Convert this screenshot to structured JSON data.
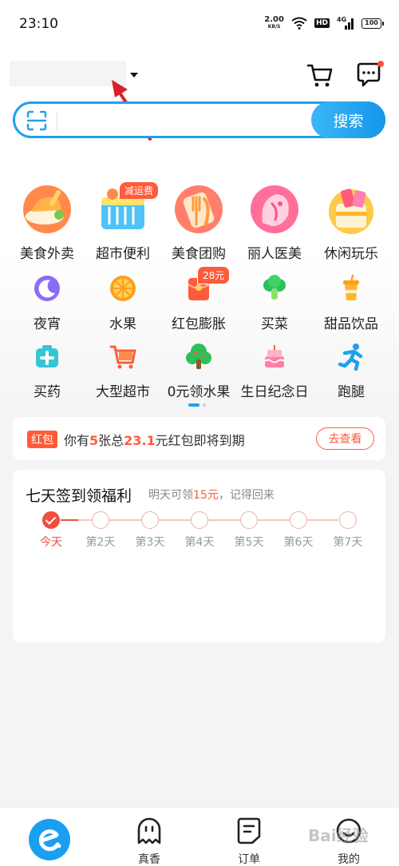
{
  "status_bar": {
    "time": "23:10",
    "net_speed_value": "2.00",
    "net_speed_unit": "KB/S",
    "hd_badge": "HD",
    "signal_label": "4G",
    "battery_text": "100"
  },
  "header": {
    "location_text": "",
    "icons": [
      "cart-icon",
      "message-icon"
    ]
  },
  "search": {
    "placeholder": "",
    "button_label": "搜索"
  },
  "main_categories": [
    {
      "label": "美食外卖",
      "icon": "food-delivery-icon"
    },
    {
      "label": "超市便利",
      "icon": "supermarket-basket-icon",
      "badge": "减运费"
    },
    {
      "label": "美食团购",
      "icon": "group-buy-food-icon"
    },
    {
      "label": "丽人医美",
      "icon": "beauty-icon"
    },
    {
      "label": "休闲玩乐",
      "icon": "leisure-icon"
    }
  ],
  "sub_categories": [
    {
      "label": "夜宵",
      "icon": "moon-icon"
    },
    {
      "label": "水果",
      "icon": "orange-icon"
    },
    {
      "label": "红包膨胀",
      "icon": "red-packet-icon",
      "badge": "28元"
    },
    {
      "label": "买菜",
      "icon": "vegetable-icon"
    },
    {
      "label": "甜品饮品",
      "icon": "drink-icon"
    },
    {
      "label": "买药",
      "icon": "medicine-box-icon"
    },
    {
      "label": "大型超市",
      "icon": "shopping-cart-icon"
    },
    {
      "label": "0元领水果",
      "icon": "tree-icon"
    },
    {
      "label": "生日纪念日",
      "icon": "cake-icon"
    },
    {
      "label": "跑腿",
      "icon": "runner-icon"
    }
  ],
  "red_packet_notice": {
    "tag": "红包",
    "text_before": "你有",
    "count": "5",
    "text_mid": "张总",
    "amount": "23.1",
    "text_after": "元红包即将到期",
    "button": "去查看"
  },
  "checkin": {
    "title": "七天签到领福利",
    "subtitle_before": "明天可领",
    "subtitle_amount": "15元",
    "subtitle_after": "，记得回来",
    "days": [
      "今天",
      "第2天",
      "第3天",
      "第4天",
      "第5天",
      "第6天",
      "第7天"
    ],
    "completed_days": 1
  },
  "bottom_nav": {
    "items": [
      {
        "label": "",
        "icon": "eleme-home-icon"
      },
      {
        "label": "真香",
        "icon": "ghost-face-icon"
      },
      {
        "label": "订单",
        "icon": "order-doc-icon"
      },
      {
        "label": "我的",
        "icon": "smile-face-icon"
      }
    ]
  },
  "watermark": "Bai经验",
  "colors": {
    "accent_blue": "#1ea1ec",
    "accent_red": "#ff5b3a"
  }
}
